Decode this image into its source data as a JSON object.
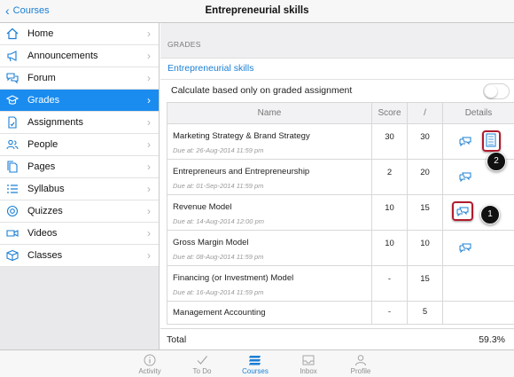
{
  "nav": {
    "back_label": "Courses",
    "title": "Entrepreneurial skills"
  },
  "colors": {
    "accent": "#1a8cf0",
    "highlight": "#b01c2e"
  },
  "sidebar": {
    "items": [
      {
        "label": "Home",
        "icon": "home-icon",
        "active": false
      },
      {
        "label": "Announcements",
        "icon": "megaphone-icon",
        "active": false
      },
      {
        "label": "Forum",
        "icon": "chat-bubbles-icon",
        "active": false
      },
      {
        "label": "Grades",
        "icon": "graduation-cap-icon",
        "active": true
      },
      {
        "label": "Assignments",
        "icon": "assignment-document-icon",
        "active": false
      },
      {
        "label": "People",
        "icon": "people-icon",
        "active": false
      },
      {
        "label": "Pages",
        "icon": "pages-icon",
        "active": false
      },
      {
        "label": "Syllabus",
        "icon": "syllabus-list-icon",
        "active": false
      },
      {
        "label": "Quizzes",
        "icon": "quiz-icon",
        "active": false
      },
      {
        "label": "Videos",
        "icon": "video-camera-icon",
        "active": false
      },
      {
        "label": "Classes",
        "icon": "classes-icon",
        "active": false
      }
    ]
  },
  "main": {
    "section_header": "GRADES",
    "course_link": "Entrepreneurial skills",
    "calc_label": "Calculate based only on graded assignment",
    "calc_toggle_on": false,
    "columns": [
      "Name",
      "Score",
      "/",
      "Details"
    ],
    "rows": [
      {
        "name": "Marketing Strategy & Brand Strategy",
        "due": "Due at: 26-Aug-2014 11:59 pm",
        "score": "30",
        "out_of": "30",
        "comment": true,
        "rubric": true
      },
      {
        "name": "Entrepreneurs and Entrepreneurship",
        "due": "Due at: 01-Sep-2014 11:59 pm",
        "score": "2",
        "out_of": "20",
        "comment": true,
        "rubric": false
      },
      {
        "name": "Revenue Model",
        "due": "Due at: 14-Aug-2014 12:00 pm",
        "score": "10",
        "out_of": "15",
        "comment": true,
        "rubric": false
      },
      {
        "name": "Gross Margin Model",
        "due": "Due at: 08-Aug-2014 11:59 pm",
        "score": "10",
        "out_of": "10",
        "comment": true,
        "rubric": false
      },
      {
        "name": "Financing (or Investment) Model",
        "due": "Due at: 16-Aug-2014 11:59 pm",
        "score": "-",
        "out_of": "15",
        "comment": false,
        "rubric": false
      },
      {
        "name": "Management Accounting",
        "due": "",
        "score": "-",
        "out_of": "5",
        "comment": false,
        "rubric": false
      }
    ],
    "callouts": [
      "1",
      "2"
    ],
    "total_label": "Total",
    "total_value": "59.3%"
  },
  "tabbar": {
    "tabs": [
      {
        "label": "Activity",
        "icon": "info-circle-icon"
      },
      {
        "label": "To Do",
        "icon": "checkmark-icon"
      },
      {
        "label": "Courses",
        "icon": "courses-stack-icon",
        "active": true
      },
      {
        "label": "Inbox",
        "icon": "inbox-icon"
      },
      {
        "label": "Profile",
        "icon": "profile-icon"
      }
    ]
  }
}
